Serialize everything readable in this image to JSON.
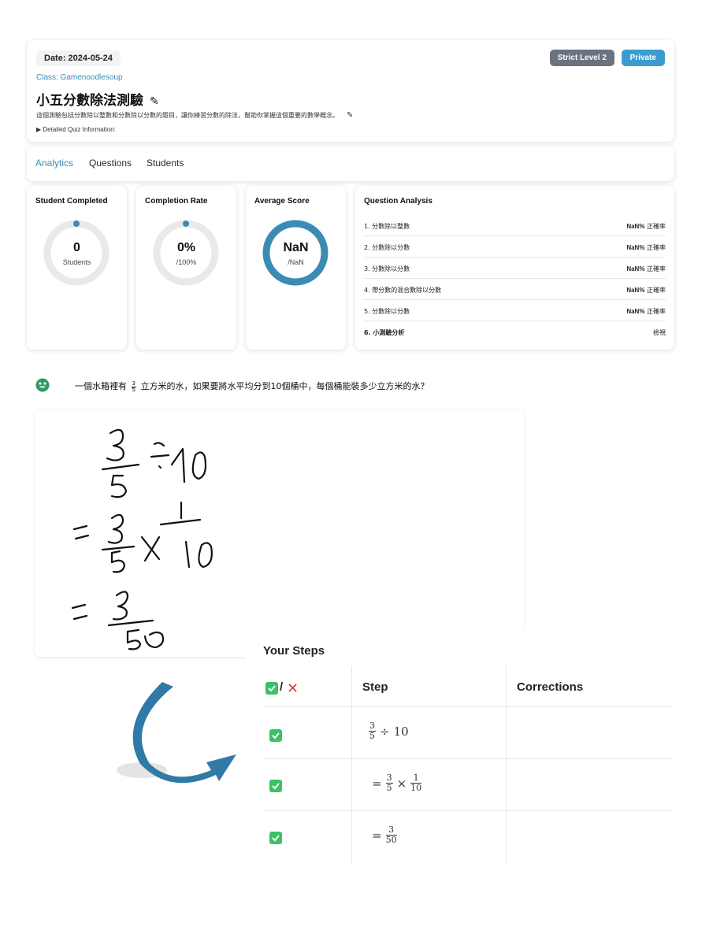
{
  "header": {
    "date": "Date: 2024-05-24",
    "class_name": "Class: Gamenoodlesoup",
    "title": "小五分數除法測驗",
    "description": "這個測驗包括分數除以整數和分數除以分數的題目，讓你練習分數的除法，幫助你掌握這個重要的數學概念。",
    "details_toggle": "▶ Detailed Quiz Information:",
    "strict_badge": "Strict Level 2",
    "privacy_badge": "Private",
    "edit_icon": "✎"
  },
  "tabs": [
    {
      "label": "Analytics",
      "active": true
    },
    {
      "label": "Questions",
      "active": false
    },
    {
      "label": "Students",
      "active": false
    }
  ],
  "stats": {
    "student_completed": {
      "title": "Student Completed",
      "value": "0",
      "sub": "Students",
      "progress": 0
    },
    "completion_rate": {
      "title": "Completion Rate",
      "value": "0%",
      "sub": "/100%",
      "progress": 0
    },
    "average_score": {
      "title": "Average Score",
      "value": "NaN",
      "sub": "/NaN",
      "progress": 1
    }
  },
  "question_analysis": {
    "title": "Question Analysis",
    "rows": [
      {
        "q": "1. 分數除以整數",
        "rate_value": "NaN%",
        "rate_label": "正確率"
      },
      {
        "q": "2. 分數除以分數",
        "rate_value": "NaN%",
        "rate_label": "正確率"
      },
      {
        "q": "3. 分數除以分數",
        "rate_value": "NaN%",
        "rate_label": "正確率"
      },
      {
        "q": "4. 帶分數的混合數除以分數",
        "rate_value": "NaN%",
        "rate_label": "正確率"
      },
      {
        "q": "5. 分數除以分數",
        "rate_value": "NaN%",
        "rate_label": "正確率"
      },
      {
        "q": "6. 小測驗分析",
        "rate_value": "",
        "rate_label": "檢視"
      }
    ]
  },
  "question": {
    "prefix": "一個水箱裡有",
    "frac_num": "3",
    "frac_den": "5",
    "suffix": "立方米的水，如果要將水平均分到10個桶中，每個桶能裝多少立方米的水？"
  },
  "steps": {
    "title": "Your Steps",
    "headers": {
      "slash": "/",
      "step": "Step",
      "corrections": "Corrections"
    },
    "rows": [
      {
        "prefix": "",
        "a_num": "3",
        "a_den": "5",
        "op": "÷",
        "b": "10",
        "correction": ""
      },
      {
        "prefix": "=",
        "a_num": "3",
        "a_den": "5",
        "op": "×",
        "b_num": "1",
        "b_den": "10",
        "correction": ""
      },
      {
        "prefix": "=",
        "a_num": "3",
        "a_den": "50",
        "correction": ""
      }
    ]
  },
  "colors": {
    "accent": "#3b8cb5",
    "ring_track": "#e9e9e9",
    "ring_fill": "#3b8cb5",
    "check": "#3cc165",
    "cross": "#e23b3b",
    "arrow": "#2f7aa6"
  }
}
